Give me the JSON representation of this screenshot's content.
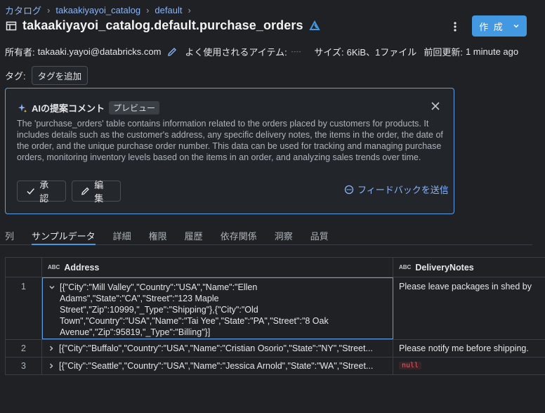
{
  "breadcrumb": {
    "catalogs": "カタログ",
    "catalog": "takaakiyayoi_catalog",
    "schema": "default"
  },
  "title": "takaakiyayoi_catalog.default.purchase_orders",
  "actions": {
    "create": "作 成"
  },
  "meta": {
    "owner_label": "所有者:",
    "owner": "takaaki.yayoi@databricks.com",
    "popular_label": "よく使用されるアイテム:",
    "popular_value": "----",
    "size_label": "サイズ:",
    "size_value": "6KiB、1ファイル",
    "updated_label": "前回更新:",
    "updated_value": "1 minute ago"
  },
  "tags": {
    "label": "タグ:",
    "add": "タグを追加"
  },
  "ai": {
    "title": "AIの提案コメント",
    "badge": "プレビュー",
    "body": "The 'purchase_orders' table contains information related to the orders placed by customers for products. It includes details such as the customer's address, any specific delivery notes, the items in the order, the date of the order, and the unique purchase order number. This data can be used for tracking and managing purchase orders, monitoring inventory levels based on the items in an order, and analyzing sales trends over time.",
    "approve": "承認",
    "edit": "編集",
    "feedback": "フィードバックを送信"
  },
  "tabs": [
    "列",
    "サンプルデータ",
    "詳細",
    "権限",
    "履歴",
    "依存関係",
    "洞察",
    "品質"
  ],
  "table": {
    "columns": [
      "Address",
      "DeliveryNotes"
    ],
    "type_icon": "ABC",
    "rows": [
      {
        "num": "1",
        "address": [
          "[{\"City\":\"Mill Valley\",\"Country\":\"USA\",\"Name\":\"Ellen",
          "Adams\",\"State\":\"CA\",\"Street\":\"123 Maple",
          "Street\",\"Zip\":10999,\"_Type\":\"Shipping\"},{\"City\":\"Old",
          "Town\",\"Country\":\"USA\",\"Name\":\"Tai Yee\",\"State\":\"PA\",\"Street\":\"8 Oak",
          "Avenue\",\"Zip\":95819,\"_Type\":\"Billing\"}]"
        ],
        "notes": "Please leave packages in shed by"
      },
      {
        "num": "2",
        "address": [
          "[{\"City\":\"Buffalo\",\"Country\":\"USA\",\"Name\":\"Cristian Osorio\",\"State\":\"NY\",\"Street..."
        ],
        "notes": "Please notify me before shipping."
      },
      {
        "num": "3",
        "address": [
          "[{\"City\":\"Seattle\",\"Country\":\"USA\",\"Name\":\"Jessica Arnold\",\"State\":\"WA\",\"Street..."
        ],
        "notes": "null"
      }
    ]
  }
}
